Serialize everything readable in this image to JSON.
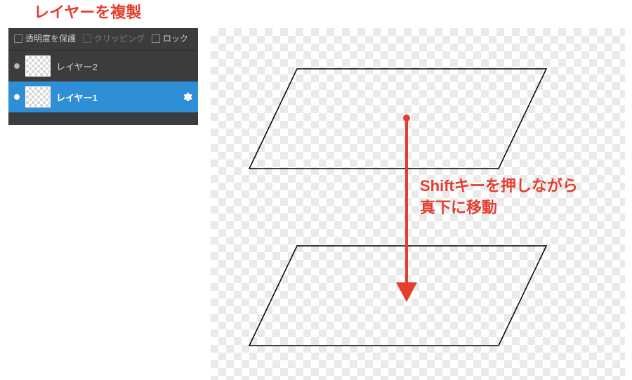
{
  "annotations": {
    "top": "レイヤーを複製",
    "right": "Shiftキーを押しながら\n真下に移動"
  },
  "panel": {
    "options": {
      "protect_opacity": {
        "label": "透明度を保護",
        "checked": false,
        "enabled": true
      },
      "clipping": {
        "label": "クリッピング",
        "checked": false,
        "enabled": false
      },
      "lock": {
        "label": "ロック",
        "checked": false,
        "enabled": true
      }
    },
    "layers": [
      {
        "name": "レイヤー2",
        "selected": false
      },
      {
        "name": "レイヤー1",
        "selected": true
      }
    ]
  },
  "icons": {
    "gear": "gear-icon"
  }
}
